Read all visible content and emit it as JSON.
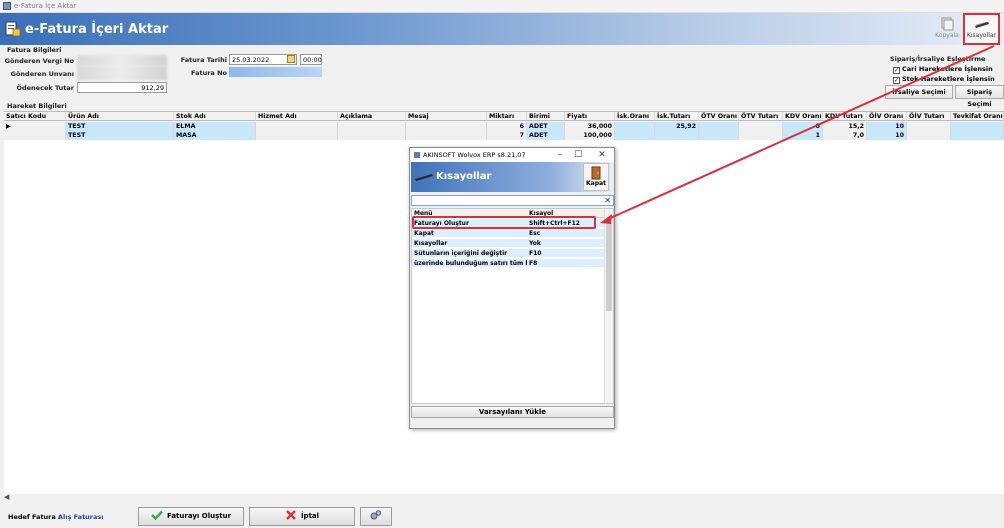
{
  "window": {
    "title": "e-Fatura İçe Aktar"
  },
  "header": {
    "title": "e-Fatura İçeri Aktar",
    "buttons": {
      "kopyala": "Kopyala",
      "kisayollar": "Kısayollar"
    }
  },
  "fatura_bilgileri": {
    "section_title": "Fatura Bilgileri",
    "gonderen_vergi_no_label": "Gönderen Vergi No",
    "gonderen_unvani_label": "Gönderen Unvanı",
    "odenecek_tutar_label": "Ödenecek Tutar",
    "odenecek_tutar_value": "912,29",
    "fatura_tarihi_label": "Fatura Tarihi",
    "fatura_tarihi_value": "25.03.2022",
    "fatura_saati_value": "00:00",
    "fatura_no_label": "Fatura No"
  },
  "siparis_irsaliye": {
    "title": "Sipariş/İrsaliye Eşleştirme",
    "check_cari": "Cari Hareketlere İşlensin",
    "check_stok": "Stok Hareketlere İşlensin",
    "irsaliye_secimi": "İrsaliye Seçimi",
    "siparis_secimi": "Sipariş Seçimi"
  },
  "hareket_bilgileri": {
    "section_title": "Hareket Bilgileri",
    "columns": [
      "Satıcı Kodu",
      "Ürün Adı",
      "Stok Adı",
      "Hizmet Adı",
      "Açıklama",
      "Mesaj",
      "Miktarı",
      "Birimi",
      "Fiyatı",
      "İsk.Oranı",
      "İsk.Tutarı",
      "ÖTV Oranı",
      "ÖTV Tutarı",
      "KDV Oranı",
      "KDV Tutarı",
      "ÖİV Oranı",
      "ÖİV Tutarı",
      "Tevkifat Oranı 1"
    ],
    "rows": [
      {
        "satici_kodu": "",
        "urun_adi": "TEST",
        "stok_adi": "ELMA",
        "miktari": "6",
        "birimi": "ADET",
        "fiyati": "36,000",
        "isk_tutari": "25,92",
        "kdv_orani": "8",
        "kdv_tutari": "15,2",
        "oiv_orani": "10"
      },
      {
        "satici_kodu": "",
        "urun_adi": "TEST",
        "stok_adi": "MASA",
        "miktari": "7",
        "birimi": "ADET",
        "fiyati": "100,000",
        "isk_tutari": "",
        "kdv_orani": "1",
        "kdv_tutari": "7,0",
        "oiv_orani": "10"
      }
    ]
  },
  "dialog": {
    "window_title": "AKINSOFT Wolvox ERP s8.21.07",
    "title": "Kısayollar",
    "kapat_label": "Kapat",
    "columns": {
      "menu": "Menü",
      "kisayol": "Kısayol"
    },
    "rows": [
      {
        "menu": "Faturayı Oluştur",
        "kisayol": "Shift+Ctrl+F12"
      },
      {
        "menu": "Kapat",
        "kisayol": "Esc"
      },
      {
        "menu": "Kısayollar",
        "kisayol": "Yok"
      },
      {
        "menu": "Sütunların içeriğini değiştir",
        "kisayol": "F10"
      },
      {
        "menu": "üzerinde bulunduğum satırı tüm kay",
        "kisayol": "F8"
      }
    ],
    "footer_button": "Varsayılanı Yükle"
  },
  "bottom": {
    "hedef_label": "Hedef Fatura :",
    "hedef_value": "Alış Faturası",
    "olustur_button": "Faturayı Oluştur",
    "iptal_button": "İptal"
  },
  "colors": {
    "highlight": "#d9313a",
    "accent": "#3a6fb8",
    "row_blue": "#c9e7fb"
  }
}
